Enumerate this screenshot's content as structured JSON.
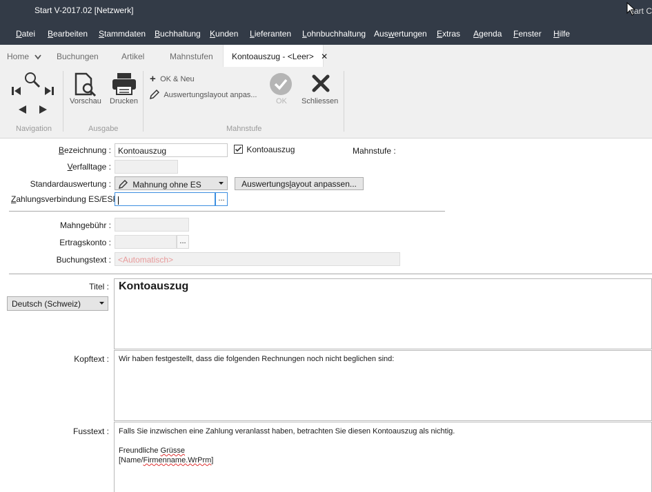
{
  "window": {
    "title": "Start V-2017.02 [Netzwerk]",
    "title_right": "tart C"
  },
  "menu": [
    {
      "label": "Datei",
      "u": "D",
      "rest": "atei"
    },
    {
      "label": "Bearbeiten",
      "u": "B",
      "rest": "earbeiten"
    },
    {
      "label": "Stammdaten",
      "u": "S",
      "rest": "tammdaten"
    },
    {
      "label": "Buchhaltung",
      "u": "B",
      "rest": "uchhaltung"
    },
    {
      "label": "Kunden",
      "u": "K",
      "rest": "unden"
    },
    {
      "label": "Lieferanten",
      "u": "L",
      "rest": "ieferanten"
    },
    {
      "label": "Lohnbuchhaltung",
      "u": "L",
      "rest": "ohnbuchhaltung"
    },
    {
      "label": "Auswertungen",
      "pre": "Aus",
      "u": "w",
      "rest": "ertungen"
    },
    {
      "label": "Extras",
      "u": "E",
      "rest": "xtras"
    },
    {
      "label": "Agenda",
      "u": "A",
      "rest": "genda"
    },
    {
      "label": "Fenster",
      "u": "F",
      "rest": "enster"
    },
    {
      "label": "Hilfe",
      "u": "H",
      "rest": "ilfe"
    }
  ],
  "tabs": {
    "home": "Home",
    "buchungen": "Buchungen",
    "artikel": "Artikel",
    "mahnstufen": "Mahnstufen",
    "active": "Kontoauszug - <Leer>",
    "close_glyph": "✕"
  },
  "ribbon": {
    "navigation_label": "Navigation",
    "ausgabe_label": "Ausgabe",
    "vorschau": "Vorschau",
    "drucken": "Drucken",
    "ok_neu": "OK & Neu",
    "auswertungslayout": "Auswertungslayout anpas...",
    "ok": "OK",
    "schliessen": "Schliessen",
    "mahnstufe_label": "Mahnstufe"
  },
  "form": {
    "bezeichnung_label_u": "B",
    "bezeichnung_label_rest": "ezeichnung :",
    "bezeichnung_value": "Kontoauszug",
    "kontoauszug_checkbox_label": "Kontoauszug",
    "kontoauszug_checked": true,
    "mahnstufe_label": "Mahnstufe :",
    "verfalltage_label_u": "V",
    "verfalltage_label_rest": "erfalltage :",
    "standardauswertung_label": "Standardauswertung :",
    "standardauswertung_value": "Mahnung ohne ES",
    "auswertungslayout_button_pre": "Auswertungs",
    "auswertungslayout_button_u": "l",
    "auswertungslayout_button_rest": "ayout anpassen...",
    "zahlungsverbindung_label_u": "Z",
    "zahlungsverbindung_label_rest": "ahlungsverbindung ES/ESR:",
    "ellipsis": "...",
    "mahngebuehr_label": "Mahngebühr :",
    "ertragskonto_label": "Ertragskonto :",
    "buchungstext_label": "Buchungstext :",
    "buchungstext_placeholder": "<Automatisch>",
    "titel_label": "Titel :",
    "language_value": "Deutsch (Schweiz)",
    "titel_value": "Kontoauszug",
    "kopftext_label": "Kopftext :",
    "kopftext_value": "Wir haben festgestellt, dass die folgenden Rechnungen noch nicht beglichen sind:",
    "fusstext_label": "Fusstext :",
    "fusstext_line1": "Falls Sie inzwischen eine Zahlung veranlasst haben, betrachten Sie diesen Kontoauszug als nichtig.",
    "fusstext_line2_pre": "Freundliche ",
    "fusstext_line2_spell": "Grüsse",
    "fusstext_line3_pre": "[Name/",
    "fusstext_line3_spell": "Firmenname.WrPrm",
    "fusstext_line3_post": "]"
  },
  "colors": {
    "titlebar_bg": "#333b47",
    "ok_disabled": "#b5b5b5",
    "placeholder": "#e89a9a"
  }
}
